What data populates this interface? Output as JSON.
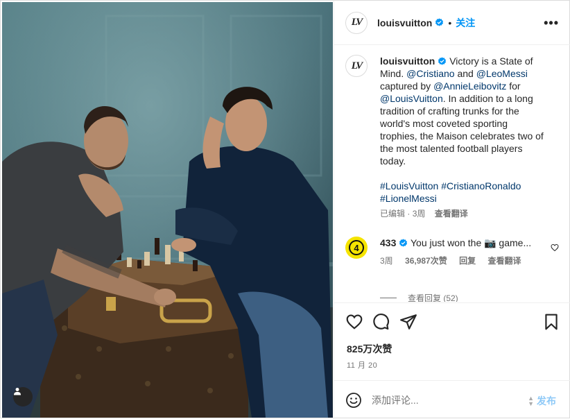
{
  "post": {
    "account": "louisvuitton",
    "avatar_mark": "LV",
    "follow_label": "关注",
    "separator": "•",
    "more_label": "•••"
  },
  "caption": {
    "username": "louisvuitton",
    "text_1": "Victory is a State of Mind.",
    "mention_1": "@Cristiano",
    "text_2": "and",
    "mention_2": "@LeoMessi",
    "text_3": "captured by",
    "mention_3": "@AnnieLeibovitz",
    "text_4": "for",
    "mention_4": "@LouisVuitton",
    "text_5": ". In addition to a long tradition of crafting trunks for the world's most coveted sporting trophies, the Maison celebrates two of the most talented football players today.",
    "hashtags": [
      "#LouisVuitton",
      "#CristianoRonaldo",
      "#LionelMessi"
    ],
    "edited_label": "已编辑",
    "time": "3周",
    "translate_label": "查看翻译"
  },
  "comment": {
    "badge_text": "4",
    "username": "433",
    "text": "You just won the 📷 game...",
    "time": "3周",
    "likes": "36,987次赞",
    "reply_label": "回复",
    "translate_label": "查看翻译",
    "view_replies": "查看回复 (52)"
  },
  "actions": {
    "likes_count": "825万次赞",
    "date": "11 月 20"
  },
  "composer": {
    "placeholder": "添加评论...",
    "post_label": "发布"
  },
  "colors": {
    "link": "#0095f6",
    "mention": "#00376b",
    "muted": "#737373",
    "badge": "#f5e400"
  }
}
